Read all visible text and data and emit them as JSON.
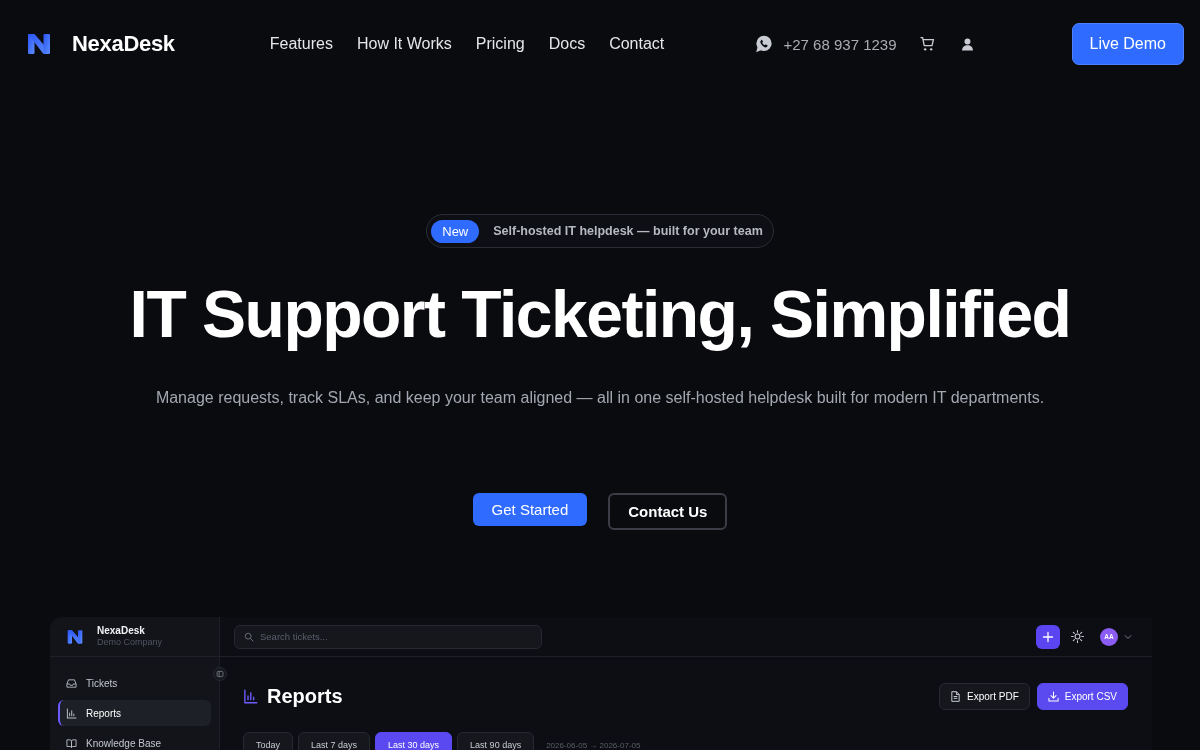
{
  "nav": {
    "brand": "NexaDesk",
    "links": [
      {
        "label": "Features"
      },
      {
        "label": "How It Works"
      },
      {
        "label": "Pricing"
      },
      {
        "label": "Docs"
      },
      {
        "label": "Contact"
      }
    ],
    "phone": "+27 68 937 1239",
    "cta": "Live Demo"
  },
  "hero": {
    "badge": {
      "tag": "New",
      "text": "Self-hosted IT helpdesk — built for your team"
    },
    "title": "IT Support Ticketing, Simplified",
    "subtitle": "Manage requests, track SLAs, and keep your team aligned — all in one self-hosted helpdesk built for modern IT departments.",
    "buttons": [
      {
        "label": "Get Started",
        "kind": "primary"
      },
      {
        "label": "Contact Us",
        "kind": "outline"
      }
    ]
  },
  "app_preview": {
    "sidebar": {
      "brand": "NexaDesk",
      "company": "Demo Company",
      "items": [
        {
          "label": "Tickets",
          "selected": false
        },
        {
          "label": "Reports",
          "selected": true
        },
        {
          "label": "Knowledge Base",
          "selected": false
        }
      ]
    },
    "search": {
      "placeholder": "Search tickets..."
    },
    "avatar": "AA",
    "page_title": "Reports",
    "actions": [
      {
        "label": "Export PDF",
        "kind": "secondary"
      },
      {
        "label": "Export CSV",
        "kind": "primary"
      }
    ],
    "ranges": [
      {
        "label": "Today",
        "selected": false
      },
      {
        "label": "Last 7 days",
        "selected": false
      },
      {
        "label": "Last 30 days",
        "selected": true
      },
      {
        "label": "Last 90 days",
        "selected": false
      }
    ],
    "date_range": "2026-06-05 → 2026-07-05"
  }
}
